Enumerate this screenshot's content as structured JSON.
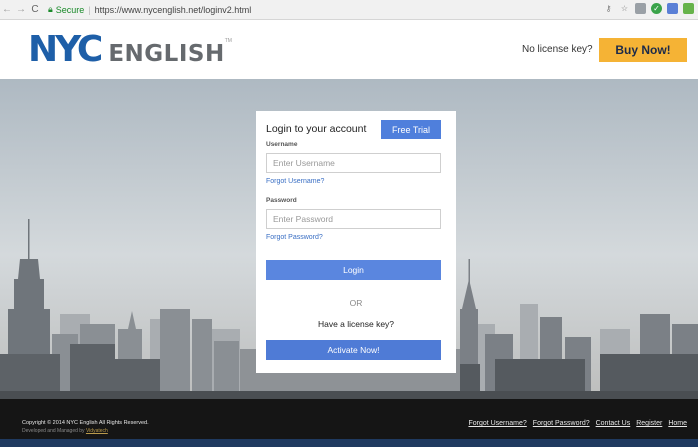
{
  "browser": {
    "secure_label": "Secure",
    "url": "https://www.nycenglish.net/loginv2.html",
    "nav": {
      "back": "←",
      "forward": "→",
      "reload": "C"
    },
    "extensions": [
      {
        "icon": "☆",
        "color": "#888"
      },
      {
        "icon": "•",
        "color": "#7a7a7a"
      },
      {
        "icon": "✓",
        "color": "#3aa34a"
      },
      {
        "icon": "▢",
        "color": "#5a7fd6"
      },
      {
        "icon": "▢",
        "color": "#66b34a"
      }
    ]
  },
  "header": {
    "logo_nyc": "NYC",
    "logo_english": "ENGLISH",
    "logo_tm": "TM",
    "no_license_text": "No license key?",
    "buy_now_label": "Buy Now!"
  },
  "login": {
    "title": "Login to your account",
    "free_trial_label": "Free Trial",
    "username_label": "Username",
    "username_placeholder": "Enter Username",
    "forgot_username": "Forgot Username?",
    "password_label": "Password",
    "password_placeholder": "Enter Password",
    "forgot_password": "Forgot Password?",
    "login_label": "Login",
    "or_text": "OR",
    "have_license_text": "Have a license key?",
    "activate_label": "Activate Now!"
  },
  "footer": {
    "copyright": "Copyright © 2014 NYC English All Rights Reserved.",
    "managed_prefix": "Developed and Managed by",
    "managed_link": "Vidyatech",
    "links": [
      "Forgot Username?",
      "Forgot Password?",
      "Contact Us",
      "Register",
      "Home"
    ]
  },
  "colors": {
    "brand_blue": "#1e5fa8",
    "buy_now": "#f5b335",
    "button_blue": "#4f7fdc",
    "footer_bg": "#151515"
  }
}
